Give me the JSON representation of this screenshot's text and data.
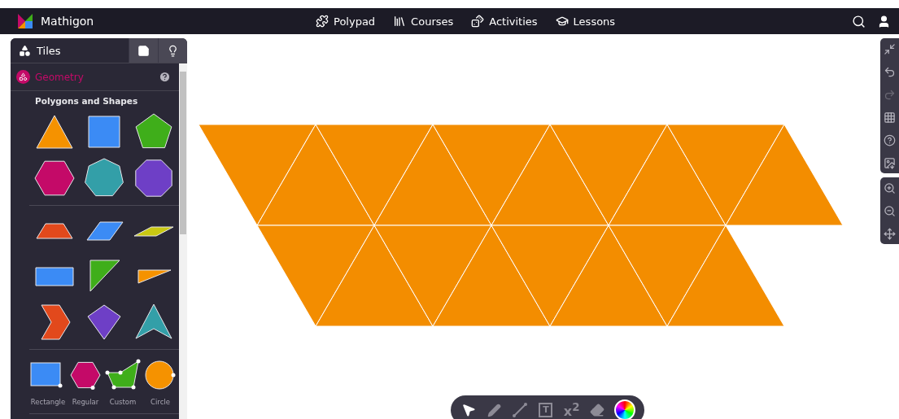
{
  "nav": {
    "brand": "Mathigon",
    "links": [
      {
        "kind": "polypad",
        "label": "Polypad"
      },
      {
        "kind": "courses",
        "label": "Courses"
      },
      {
        "kind": "activities",
        "label": "Activities"
      },
      {
        "kind": "lessons",
        "label": "Lessons"
      }
    ]
  },
  "sidebar": {
    "tabs": [
      {
        "kind": "tiles",
        "label": "Tiles",
        "selected": true
      },
      {
        "kind": "notes",
        "selected": false
      },
      {
        "kind": "tips",
        "selected": false
      }
    ],
    "category": "Geometry",
    "sections": [
      {
        "kind": "grid",
        "title": "Polygons and Shapes",
        "tiles": [
          {
            "kind": "triangle",
            "color": "#f59200"
          },
          {
            "kind": "square",
            "color": "#3b8bf5"
          },
          {
            "kind": "pentagon",
            "color": "#3fae1a"
          },
          {
            "kind": "hexagon",
            "color": "#c40a68"
          },
          {
            "kind": "heptagon",
            "color": "#339fa8"
          },
          {
            "kind": "octagon",
            "color": "#6e3fc6"
          }
        ]
      },
      {
        "kind": "grid",
        "tiles": [
          {
            "kind": "trapezoid",
            "color": "#e2491c"
          },
          {
            "kind": "parallelogram",
            "color": "#3b8bf5"
          },
          {
            "kind": "rhombus",
            "color": "#c9c812"
          },
          {
            "kind": "rectangle",
            "color": "#3b8bf5"
          },
          {
            "kind": "right-triangle",
            "color": "#3fae1a"
          },
          {
            "kind": "thin-triangle",
            "color": "#f59200"
          },
          {
            "kind": "chevron",
            "color": "#e2491c"
          },
          {
            "kind": "kite",
            "color": "#6e3fc6"
          },
          {
            "kind": "dart",
            "color": "#339fa8"
          }
        ]
      },
      {
        "kind": "labeled",
        "tiles": [
          {
            "kind": "rectangle-tool",
            "color": "#3b8bf5",
            "label": "Rectangle"
          },
          {
            "kind": "regular-tool",
            "color": "#c40a68",
            "label": "Regular"
          },
          {
            "kind": "custom-tool",
            "color": "#3fae1a",
            "label": "Custom"
          },
          {
            "kind": "circle-tool",
            "color": "#f59200",
            "label": "Circle"
          }
        ]
      }
    ]
  },
  "right_toolbar": [
    [
      {
        "kind": "fullscreen",
        "disabled": false
      },
      {
        "kind": "undo",
        "disabled": false
      },
      {
        "kind": "redo",
        "disabled": true
      },
      {
        "kind": "grid",
        "disabled": false
      },
      {
        "kind": "help",
        "disabled": false
      },
      {
        "kind": "download",
        "disabled": false
      }
    ],
    [
      {
        "kind": "zoom-in",
        "disabled": false
      },
      {
        "kind": "zoom-out",
        "disabled": false
      },
      {
        "kind": "move",
        "disabled": false
      }
    ]
  ],
  "bottom_toolbar": [
    {
      "kind": "select",
      "selected": true
    },
    {
      "kind": "pen",
      "selected": false
    },
    {
      "kind": "line",
      "selected": false
    },
    {
      "kind": "text",
      "label": "T",
      "selected": false
    },
    {
      "kind": "equation",
      "label": "x$^{2}$",
      "selected": false
    },
    {
      "kind": "eraser",
      "selected": false
    },
    {
      "kind": "color",
      "selected": false
    }
  ]
}
